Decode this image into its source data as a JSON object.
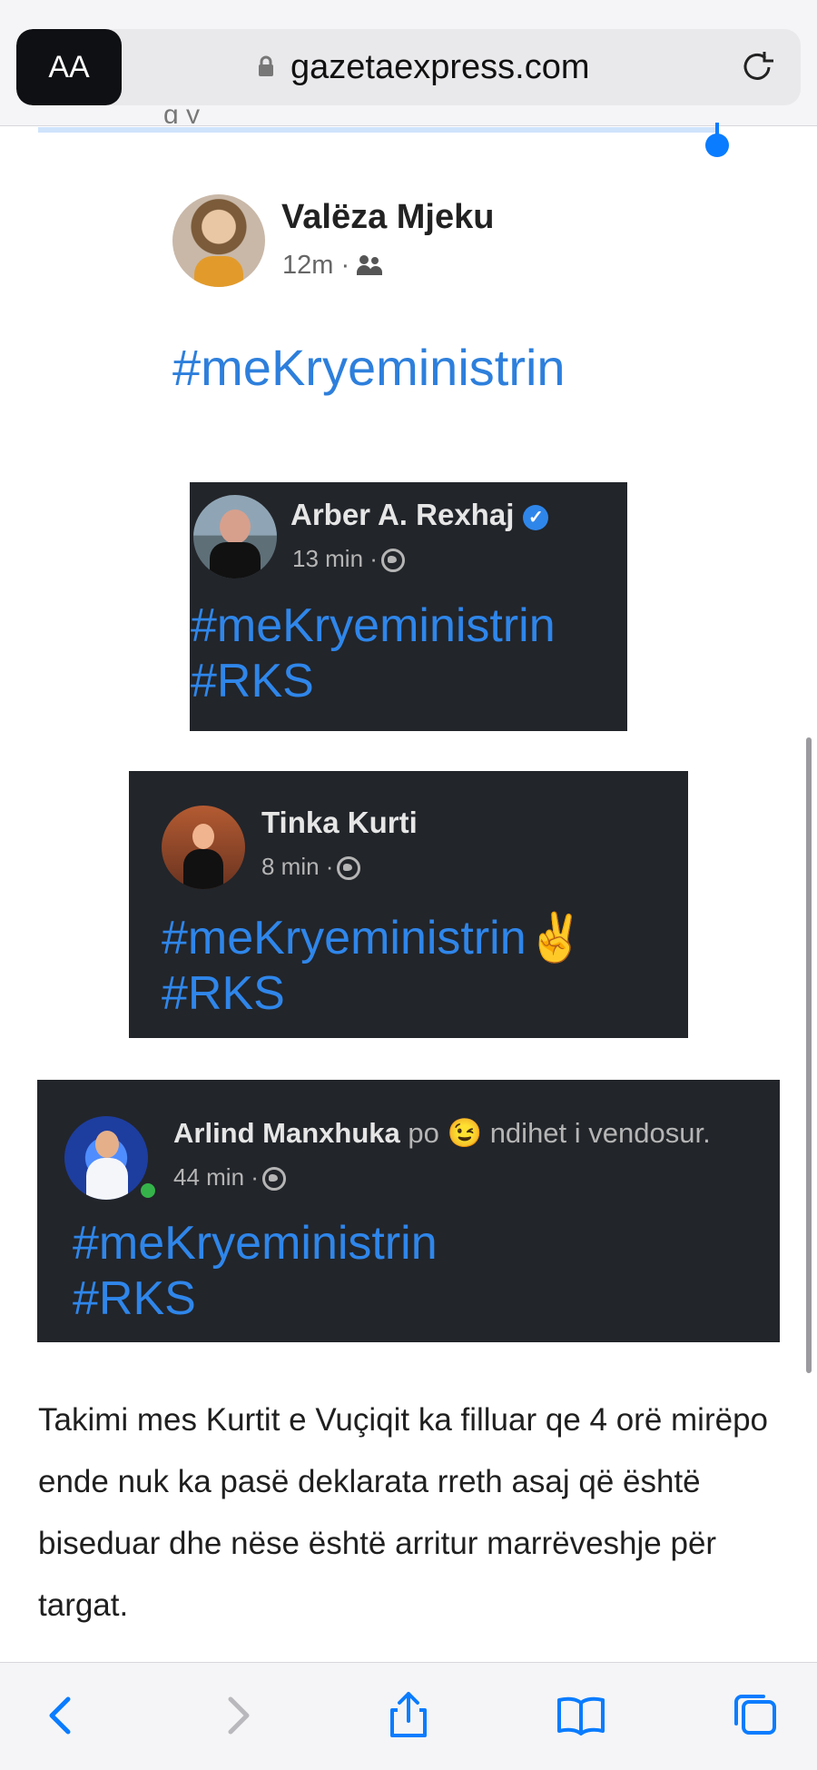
{
  "browser": {
    "reader_label": "AA",
    "url": "gazetaexpress.com"
  },
  "posts": [
    {
      "author": "Valëza Mjeku",
      "time": "12m ·",
      "tags": [
        "#meKryeministrin"
      ]
    },
    {
      "author": "Arber A. Rexhaj",
      "time": "13 min ·",
      "tags": [
        "#meKryeministrin",
        "#RKS"
      ]
    },
    {
      "author": "Tinka Kurti",
      "time": "8 min ·",
      "tags": [
        "#meKryeministrin✌️",
        "#RKS"
      ]
    },
    {
      "author": "Arlind Manxhuka",
      "status": "po 😉 ndihet i vendosur.",
      "time": "44 min ·",
      "tags": [
        "#meKryeministrin",
        "#RKS"
      ]
    }
  ],
  "article": {
    "text": "Takimi mes Kurtit e Vuçiqit ka filluar qe 4 orë mirëpo ende nuk ka pasë deklarata rreth asaj që është biseduar dhe nëse është arritur marrëveshje për targat."
  },
  "toolbar": {
    "icons": [
      "back-icon",
      "forward-icon",
      "share-icon",
      "bookmarks-icon",
      "tabs-icon"
    ]
  }
}
